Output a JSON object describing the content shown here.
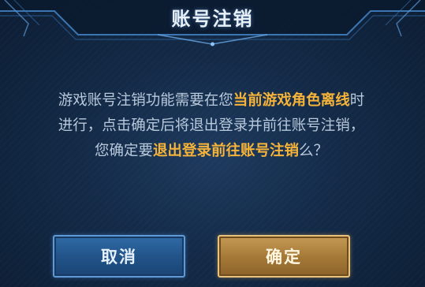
{
  "dialog": {
    "title": "账号注销",
    "message": {
      "line1_pre": "游戏账号注销功能需要在您",
      "line1_hl": "当前游戏角色离线",
      "line1_post": "时",
      "line2": "进行，点击确定后将退出登录并前往账号注销，",
      "line3_pre": "您确定要",
      "line3_hl": "退出登录前往账号注销",
      "line3_post": "么？"
    },
    "cancel_label": "取消",
    "confirm_label": "确定"
  },
  "colors": {
    "highlight": "#f5b33a",
    "cancel_button": "#22548a",
    "confirm_button": "#a67a38",
    "background": "#132a47"
  }
}
